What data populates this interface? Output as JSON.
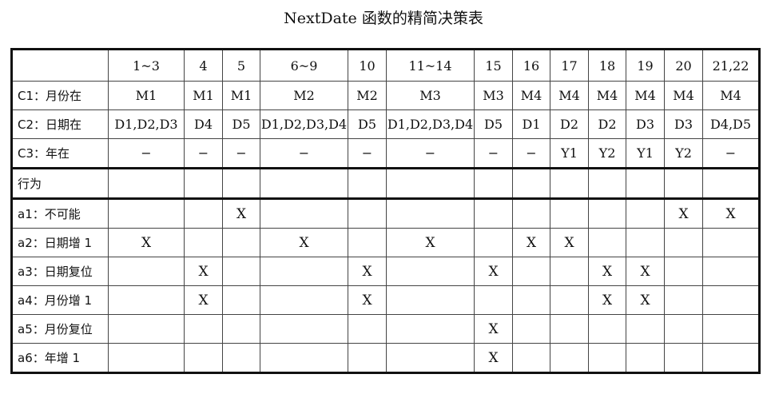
{
  "title": "NextDate 函数的精简决策表",
  "table": {
    "columns": [
      "",
      "1~3",
      "4",
      "5",
      "6~9",
      "10",
      "11~14",
      "15",
      "16",
      "17",
      "18",
      "19",
      "20",
      "21,22"
    ],
    "conditions": [
      {
        "label": "C1：月份在",
        "cells": [
          "M1",
          "M1",
          "M1",
          "M2",
          "M2",
          "M3",
          "M3",
          "M4",
          "M4",
          "M4",
          "M4",
          "M4",
          "M4"
        ]
      },
      {
        "label": "C2：日期在",
        "cells": [
          "D1,D2,D3",
          "D4",
          "D5",
          "D1,D2,D3,D4",
          "D5",
          "D1,D2,D3,D4",
          "D5",
          "D1",
          "D2",
          "D2",
          "D3",
          "D3",
          "D4,D5"
        ]
      },
      {
        "label": "C3：年在",
        "cells": [
          "−",
          "−",
          "−",
          "−",
          "−",
          "−",
          "−",
          "−",
          "Y1",
          "Y2",
          "Y1",
          "Y2",
          "−"
        ]
      }
    ],
    "action_header": {
      "label": "行为",
      "cells": [
        "",
        "",
        "",
        "",
        "",
        "",
        "",
        "",
        "",
        "",
        "",
        "",
        ""
      ]
    },
    "actions": [
      {
        "label": "a1：不可能",
        "cells": [
          "",
          "",
          "X",
          "",
          "",
          "",
          "",
          "",
          "",
          "",
          "",
          "X",
          "X"
        ]
      },
      {
        "label": "a2：日期增 1",
        "cells": [
          "X",
          "",
          "",
          "X",
          "",
          "X",
          "",
          "X",
          "X",
          "",
          "",
          "",
          ""
        ]
      },
      {
        "label": "a3：日期复位",
        "cells": [
          "",
          "X",
          "",
          "",
          "X",
          "",
          "X",
          "",
          "",
          "X",
          "X",
          "",
          ""
        ]
      },
      {
        "label": "a4：月份增 1",
        "cells": [
          "",
          "X",
          "",
          "",
          "X",
          "",
          "",
          "",
          "",
          "X",
          "X",
          "",
          ""
        ]
      },
      {
        "label": "a5：月份复位",
        "cells": [
          "",
          "",
          "",
          "",
          "",
          "",
          "X",
          "",
          "",
          "",
          "",
          "",
          ""
        ]
      },
      {
        "label": "a6：年增 1",
        "cells": [
          "",
          "",
          "",
          "",
          "",
          "",
          "X",
          "",
          "",
          "",
          "",
          "",
          ""
        ]
      }
    ]
  }
}
